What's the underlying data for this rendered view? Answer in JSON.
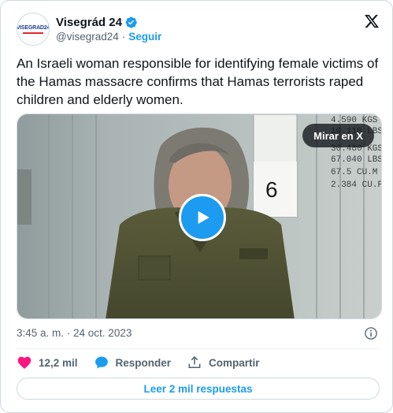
{
  "account": {
    "display_name": "Visegrád 24",
    "handle": "@visegrad24",
    "separator": "·",
    "follow_label": "Seguir",
    "avatar_text": "VISEGRAD24"
  },
  "tweet": {
    "text": "An Israeli woman responsible for identifying female victims of the Hamas massacre confirms that Hamas terrorists raped children and elderly women.",
    "timestamp": "3:45 a. m. · 24 oct. 2023"
  },
  "media": {
    "watch_label": "Mirar en X",
    "container_text": [
      "4.590 KGS",
      "10.110 LBS",
      "30.480 KGS",
      "67.040 LBS",
      "67.5 CU.M",
      "2.384 CU.FT"
    ],
    "sign_number": "6"
  },
  "actions": {
    "likes": "12,2 mil",
    "reply_label": "Responder",
    "share_label": "Compartir"
  },
  "read_replies_label": "Leer 2 mil respuestas",
  "colors": {
    "accent": "#1d9bf0",
    "like": "#f91880",
    "text_primary": "#0f1419",
    "text_secondary": "#536471"
  }
}
